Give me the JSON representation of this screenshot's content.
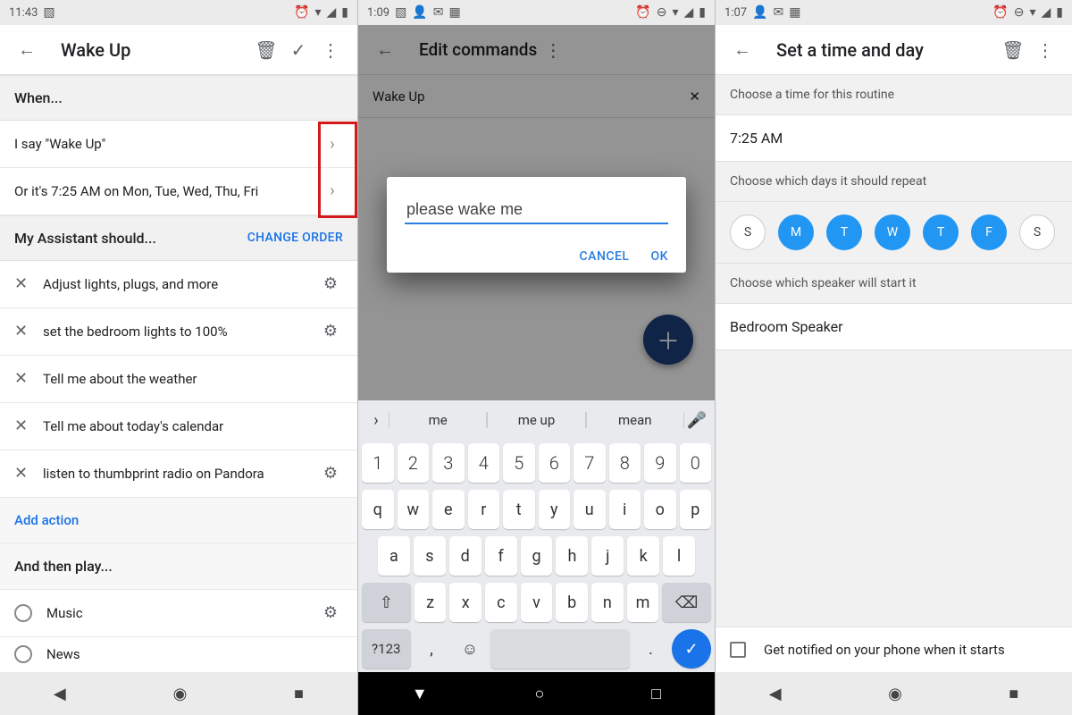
{
  "p1": {
    "time": "11:43",
    "title": "Wake Up",
    "when_hdr": "When...",
    "when_items": [
      "I say \"Wake Up\"",
      "Or it's 7:25 AM on Mon, Tue, Wed, Thu, Fri"
    ],
    "assist_hdr": "My Assistant should...",
    "change_order": "CHANGE ORDER",
    "actions": [
      {
        "label": "Adjust lights, plugs, and more",
        "gear": true
      },
      {
        "label": "set the bedroom lights to 100%",
        "gear": true
      },
      {
        "label": "Tell me about the weather",
        "gear": false
      },
      {
        "label": "Tell me about today's calendar",
        "gear": false
      },
      {
        "label": "listen to thumbprint radio on Pandora",
        "gear": true
      }
    ],
    "add_action": "Add action",
    "and_then": "And then play...",
    "play": [
      "Music",
      "News"
    ]
  },
  "p2": {
    "time": "1:09",
    "title": "Edit commands",
    "chip": "Wake Up",
    "input_value": "please wake me",
    "cancel": "CANCEL",
    "ok": "OK",
    "suggestions": [
      "me",
      "me up",
      "mean"
    ],
    "num_row": [
      "1",
      "2",
      "3",
      "4",
      "5",
      "6",
      "7",
      "8",
      "9",
      "0"
    ],
    "row_q": [
      "q",
      "w",
      "e",
      "r",
      "t",
      "y",
      "u",
      "i",
      "o",
      "p"
    ],
    "row_a": [
      "a",
      "s",
      "d",
      "f",
      "g",
      "h",
      "j",
      "k",
      "l"
    ],
    "row_z": [
      "z",
      "x",
      "c",
      "v",
      "b",
      "n",
      "m"
    ],
    "sym": "?123"
  },
  "p3": {
    "time": "1:07",
    "title": "Set a time and day",
    "choose_time": "Choose a time for this routine",
    "time_value": "7:25 AM",
    "choose_days": "Choose which days it should repeat",
    "days": [
      {
        "l": "S",
        "on": false
      },
      {
        "l": "M",
        "on": true
      },
      {
        "l": "T",
        "on": true
      },
      {
        "l": "W",
        "on": true
      },
      {
        "l": "T",
        "on": true
      },
      {
        "l": "F",
        "on": true
      },
      {
        "l": "S",
        "on": false
      }
    ],
    "choose_speaker": "Choose which speaker will start it",
    "speaker": "Bedroom Speaker",
    "notify": "Get notified on your phone when it starts"
  }
}
